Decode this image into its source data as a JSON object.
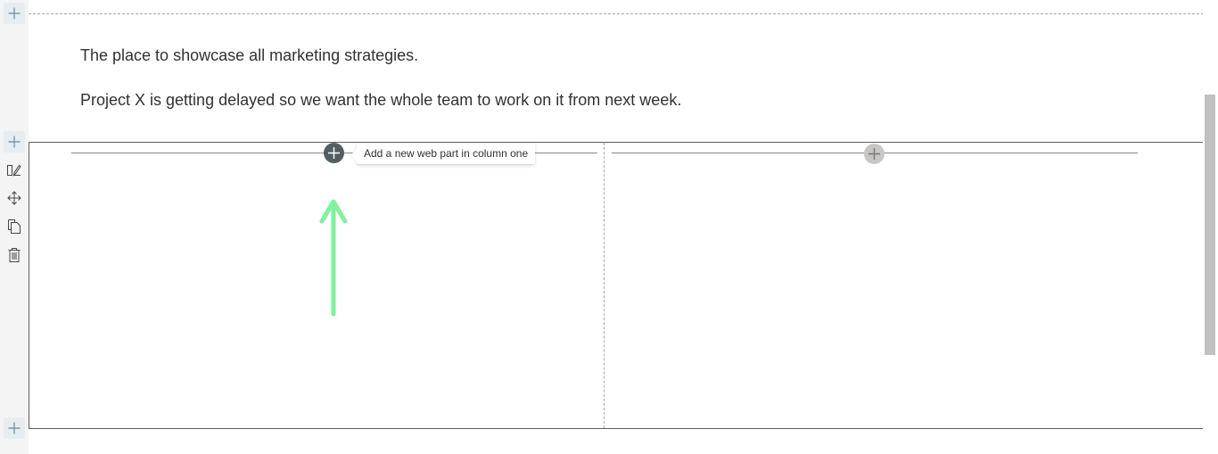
{
  "content": {
    "paragraph_1": "The place to showcase all marketing strategies.",
    "paragraph_2": "Project X is getting delayed so we want the whole team to work on it from next week."
  },
  "section": {
    "tooltip": "Add a new web part in column one"
  },
  "icons": {
    "add_section": "plus-icon",
    "edit_section": "edit-section-icon",
    "move_section": "move-icon",
    "duplicate_section": "duplicate-icon",
    "delete_section": "delete-icon",
    "add_web_part": "plus-icon",
    "annotation": "up-arrow-icon"
  },
  "colors": {
    "accent_add_active": "#525e63",
    "add_idle": "#c8c6c4",
    "annotation_arrow": "#7ef29d",
    "rail_background": "#f4f4f4"
  }
}
